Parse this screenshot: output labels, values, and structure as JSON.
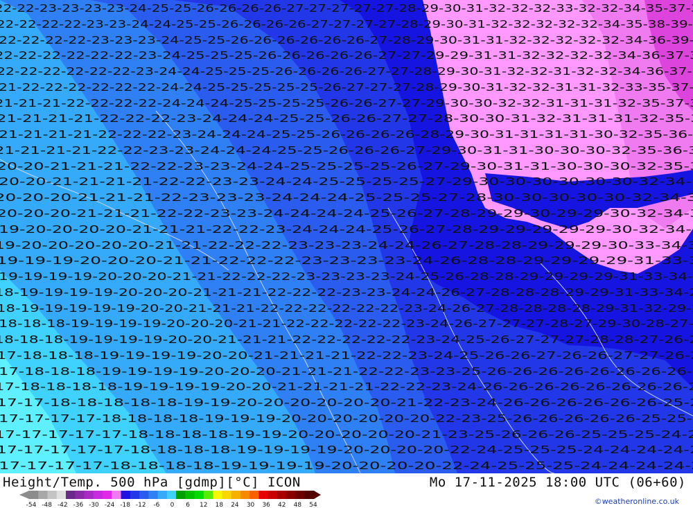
{
  "map": {
    "region_colors": {
      "cyan_light": "#5ff0ff",
      "cyan": "#3fd2ff",
      "sky": "#35aafa",
      "blue_mid": "#2f80f4",
      "blue": "#2a5cef",
      "royal": "#2238e8",
      "navy": "#1614e0",
      "violet_light": "#ff99ff",
      "violet": "#f07af0",
      "magenta": "#dd44dd"
    },
    "rows": [
      "22-22-23-23-23-23-24-25-25-26-26-26-26-27-27-27-27-27-28-29-30-31-32-32-32-33-32-32-34-35-37-38",
      "22-22-22-22-23-23-24-24-25-25-26-26-26-26-27-27-27-27-28-29-30-31-32-32-32-32-32-34-35-38-39-39",
      "22-22-22-22-23-23-23-24-25-25-26-26-26-26-26-26-27-28-29-30-31-31-32-32-32-32-32-34-36-39-38",
      "22-22-22-22-22-22-23-24-25-25-25-26-26-26-26-26-27-27-29-29-31-31-32-32-32-32-34-36-37-38",
      "22-22-22-22-22-22-23-24-24-25-25-25-26-26-26-26-27-27-28-29-30-31-32-32-31-32-32-34-36-37-38",
      "21-22-22-22-22-22-22-24-24-25-25-25-25-25-26-27-27-27-28-29-30-31-32-32-31-31-32-33-35-37-37",
      "21-21-21-22-22-22-22-24-24-24-25-25-25-25-26-26-27-27-29-30-30-32-32-31-31-31-32-35-37-37",
      "21-21-21-21-22-22-22-23-24-24-24-25-25-26-26-27-27-28-30-30-31-32-31-31-31-32-35-36",
      "21-21-21-21-22-22-22-23-24-24-24-25-25-26-26-26-26-28-29-30-31-31-31-31-30-32-35-36-37",
      "21-21-21-21-22-22-23-23-24-24-24-25-25-26-26-26-27-29-30-31-31-30-30-30-32-35-36-37",
      "20-20-21-21-21-22-22-23-23-24-24-25-25-25-25-26-27-29-30-31-31-30-30-30-32-35-36",
      "20-20-21-21-21-21-22-22-23-23-24-24-25-25-25-25-27-29-30-30-30-30-30-30-32-34-35",
      "20-20-20-21-21-21-22-23-23-23-24-24-24-25-25-25-27-28-30-30-30-30-30-32-34-35",
      "20-20-20-21-21-21-22-22-23-23-24-24-24-24-25-26-27-28-29-29-30-29-29-30-32-34-34",
      "19-20-20-20-20-21-21-21-22-22-23-24-24-24-25-26-27-28-29-29-29-29-29-30-32-34-34",
      "19-20-20-20-20-20-21-21-22-22-22-23-23-23-24-24-26-27-28-28-29-29-29-30-33-34-35",
      "19-19-19-20-20-20-21-21-22-22-22-23-23-23-23-24-26-28-28-29-29-29-29-31-33-34",
      "19-19-19-19-20-20-20-21-21-22-22-22-23-23-23-23-24-25-26-28-28-29-29-29-29-31-33-34-34",
      "18-19-19-19-19-20-20-20-21-21-21-22-22-22-23-23-24-24-26-27-28-28-28-29-29-31-33-34-28",
      "18-19-19-19-19-19-20-20-21-21-21-22-22-22-22-22-22-23-24-26-27-28-28-28-28-29-31-32-29-29",
      "18-18-18-19-19-19-19-20-20-20-21-21-22-22-22-22-22-23-24-26-27-27-27-28-27-29-30-28-27-28",
      "18-18-18-19-19-19-19-20-20-21-21-21-22-22-22-22-22-23-24-25-26-27-27-27-28-28-27-26-26",
      "17-18-18-18-19-19-19-19-20-20-21-21-21-21-22-22-23-24-25-26-26-27-26-26-27-27-26-26",
      "17-18-18-18-19-19-19-19-20-20-20-21-21-21-22-22-23-23-25-26-26-26-26-26-26-26-26-26",
      "17-18-18-18-18-19-19-19-19-20-20-21-21-21-21-22-22-23-24-26-26-26-26-26-26-26-26-25",
      "17-17-18-18-18-18-18-19-19-20-20-20-20-20-20-21-22-23-24-26-26-26-26-26-26-25-24",
      "17-17-17-17-18-18-18-18-19-19-19-20-20-20-20-20-20-22-23-25-26-26-26-26-26-25-25-24",
      "17-17-17-17-17-18-18-18-18-19-19-20-20-20-20-20-21-23-25-26-26-26-25-25-25-24-24",
      "17-17-17-17-17-18-18-18-18-19-19-19-19-20-20-20-20-22-24-25-25-25-24-24-24-24-23",
      "17-17-17-17-18-18-18-18-19-19-19-19-20-20-20-20-22-24-25-25-25-24-24-24-24-23"
    ]
  },
  "footer": {
    "title": "Height/Temp. 500 hPa [gdmp][°C] ICON",
    "datetime": "Mo 17-11-2025 18:00 UTC (06+60)",
    "credit": "©weatheronline.co.uk"
  },
  "legend": {
    "tick_labels": [
      "-54",
      "-48",
      "-42",
      "-36",
      "-30",
      "-24",
      "-18",
      "-12",
      "-6",
      "0",
      "6",
      "12",
      "18",
      "24",
      "30",
      "36",
      "42",
      "48",
      "54"
    ],
    "colors": [
      "#8c8c8c",
      "#a8a8a8",
      "#c4c4c4",
      "#e0e0e0",
      "#6a2a8a",
      "#8a2aa6",
      "#a82ac4",
      "#c82ae0",
      "#e02ae8",
      "#f07af0",
      "#1c14e0",
      "#2238e8",
      "#2a5cef",
      "#2f80f4",
      "#35aafa",
      "#3fd2ff",
      "#00a000",
      "#00c000",
      "#00dc00",
      "#58ec00",
      "#f8f800",
      "#f8d800",
      "#f8b000",
      "#f88800",
      "#f86000",
      "#e80000",
      "#c80000",
      "#a80000",
      "#880000",
      "#6a0000",
      "#520000"
    ]
  }
}
